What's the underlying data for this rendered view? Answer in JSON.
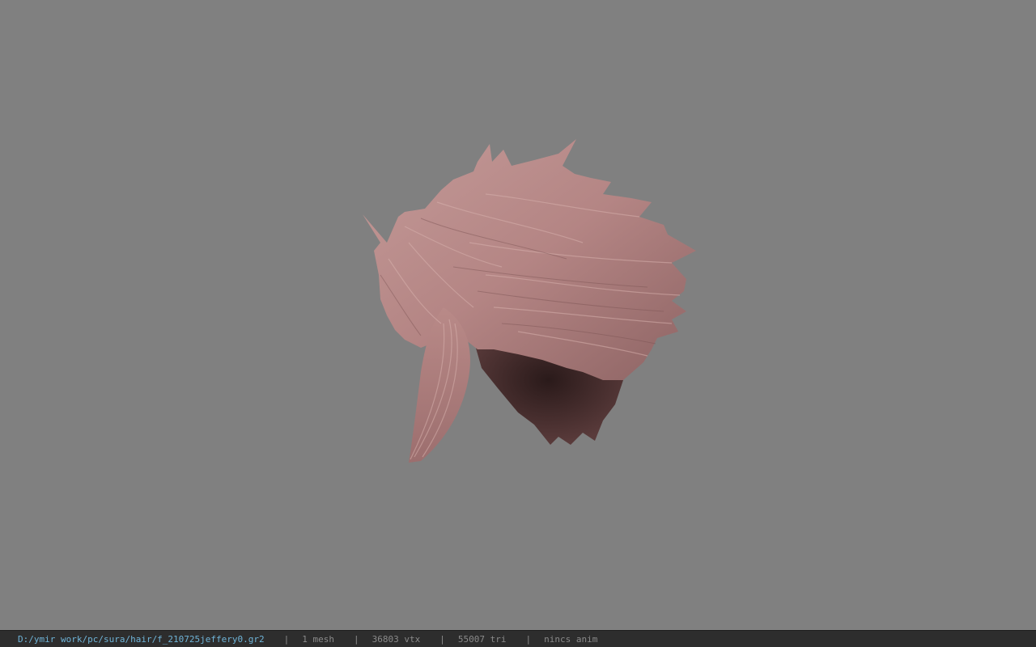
{
  "viewer": {
    "background_color": "#808080",
    "hair_color": "#b88a8a",
    "hair_shadow_color": "#3a2424"
  },
  "status": {
    "file_path": "D:/ymir work/pc/sura/hair/f_210725jeffery0.gr2",
    "separator": "|",
    "mesh": "1 mesh",
    "vertices": "36803 vtx",
    "triangles": "55007 tri",
    "anim": "nincs anim",
    "path_color": "#6fb4d8",
    "bar_color": "#2d2d2d"
  }
}
